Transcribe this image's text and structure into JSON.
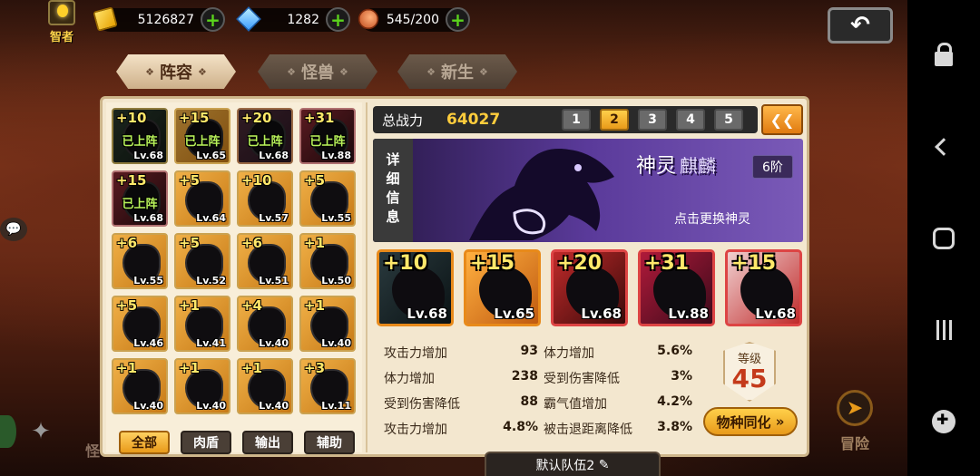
{
  "topbar": {
    "sage_label": "智者",
    "gold": "5126827",
    "gems": "1282",
    "stamina": "545/200",
    "plus_symbol": "+",
    "back_symbol": "↶"
  },
  "tabs": [
    {
      "label": "阵容",
      "active": true
    },
    {
      "label": "怪兽",
      "active": false
    },
    {
      "label": "新生",
      "active": false
    }
  ],
  "monster_grid": [
    {
      "plus": "+10",
      "lv": "Lv.68",
      "status": "已上阵"
    },
    {
      "plus": "+15",
      "lv": "Lv.65",
      "status": "已上阵"
    },
    {
      "plus": "+20",
      "lv": "Lv.68",
      "status": "已上阵"
    },
    {
      "plus": "+31",
      "lv": "Lv.88",
      "status": "已上阵"
    },
    {
      "plus": "+15",
      "lv": "Lv.68",
      "status": "已上阵"
    },
    {
      "plus": "+5",
      "lv": "Lv.64",
      "status": ""
    },
    {
      "plus": "+10",
      "lv": "Lv.57",
      "status": ""
    },
    {
      "plus": "+5",
      "lv": "Lv.55",
      "status": ""
    },
    {
      "plus": "+6",
      "lv": "Lv.55",
      "status": ""
    },
    {
      "plus": "+5",
      "lv": "Lv.52",
      "status": ""
    },
    {
      "plus": "+6",
      "lv": "Lv.51",
      "status": ""
    },
    {
      "plus": "+1",
      "lv": "Lv.50",
      "status": ""
    },
    {
      "plus": "+5",
      "lv": "Lv.46",
      "status": ""
    },
    {
      "plus": "+1",
      "lv": "Lv.41",
      "status": ""
    },
    {
      "plus": "+4",
      "lv": "Lv.40",
      "status": ""
    },
    {
      "plus": "+1",
      "lv": "Lv.40",
      "status": ""
    },
    {
      "plus": "+1",
      "lv": "Lv.40",
      "status": ""
    },
    {
      "plus": "+1",
      "lv": "Lv.40",
      "status": ""
    },
    {
      "plus": "+1",
      "lv": "Lv.40",
      "status": ""
    },
    {
      "plus": "+3",
      "lv": "Lv.11",
      "status": ""
    }
  ],
  "filters": [
    {
      "label": "全部",
      "active": true
    },
    {
      "label": "肉盾",
      "active": false
    },
    {
      "label": "输出",
      "active": false
    },
    {
      "label": "辅助",
      "active": false
    }
  ],
  "power": {
    "label": "总战力",
    "value": "64027",
    "pages": [
      "1",
      "2",
      "3",
      "4",
      "5"
    ],
    "active_page": "2"
  },
  "spirit": {
    "detail_label": "详细信息",
    "kind": "神灵",
    "name": "麒麟",
    "rank": "6阶",
    "hint": "点击更换神灵"
  },
  "team_slots": [
    {
      "plus": "+10",
      "lv": "Lv.68"
    },
    {
      "plus": "+15",
      "lv": "Lv.65"
    },
    {
      "plus": "+20",
      "lv": "Lv.68"
    },
    {
      "plus": "+31",
      "lv": "Lv.88"
    },
    {
      "plus": "+15",
      "lv": "Lv.68"
    }
  ],
  "stats": [
    {
      "label": "攻击力增加",
      "value": "93"
    },
    {
      "label": "体力增加",
      "value": "5.6%"
    },
    {
      "label": "体力增加",
      "value": "238"
    },
    {
      "label": "受到伤害降低",
      "value": "3%"
    },
    {
      "label": "受到伤害降低",
      "value": "88"
    },
    {
      "label": "霸气值增加",
      "value": "4.2%"
    },
    {
      "label": "攻击力增加",
      "value": "4.8%"
    },
    {
      "label": "被击退距离降低",
      "value": "3.8%"
    }
  ],
  "level": {
    "label": "等级",
    "value": "45",
    "sync_label": "物种同化"
  },
  "team_name": "默认队伍2",
  "bottom": {
    "left_label": "怪",
    "adventure_label": "冒险"
  }
}
